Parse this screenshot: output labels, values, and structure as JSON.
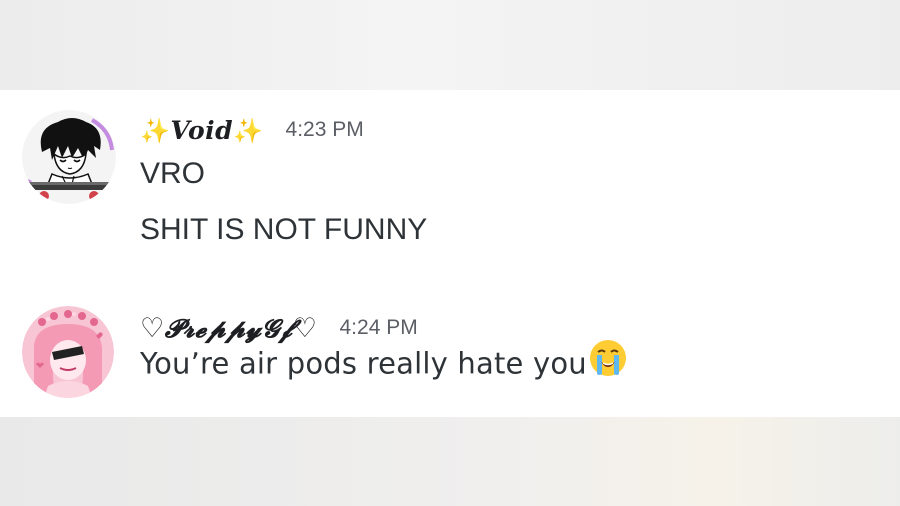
{
  "messages": [
    {
      "author": {
        "prefix": "✨",
        "name": "Void",
        "suffix": "✨",
        "avatar_icon": "anime-boy-skateboard-avatar"
      },
      "timestamp": "4:23 PM",
      "lines": [
        "VRO",
        "SHIT IS NOT FUNNY"
      ]
    },
    {
      "author": {
        "prefix": "♡",
        "name": "𝓟𝓻𝓮𝓹𝓹𝔂𝓖𝓯",
        "suffix": "♡",
        "avatar_icon": "pink-anime-girl-avatar"
      },
      "timestamp": "4:24 PM",
      "lines": [
        "You’re air pods really hate you"
      ],
      "emoji": "loudly-crying-face-icon"
    }
  ],
  "colors": {
    "panel_bg": "#ffffff",
    "outer_bg": "#ededed",
    "text": "#2e3338",
    "timestamp": "#5c5e66",
    "sparkle": "#f2c21b",
    "avatar_pink": "#f6b6c9"
  }
}
